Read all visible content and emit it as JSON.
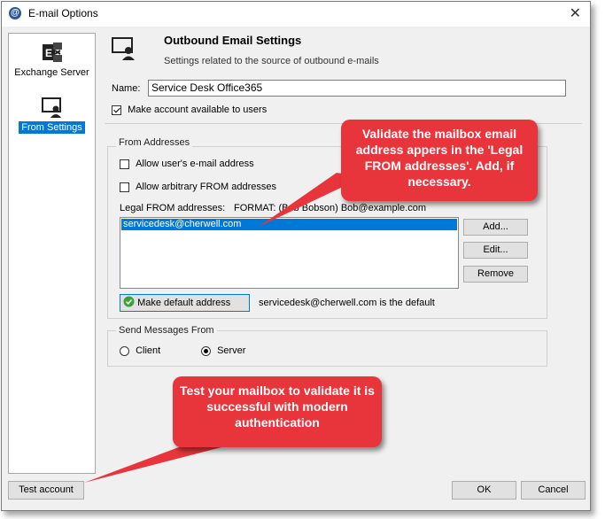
{
  "window": {
    "title": "E-mail Options",
    "close_symbol": "✕"
  },
  "sidebar": {
    "items": [
      {
        "label": "Exchange Server",
        "selected": false
      },
      {
        "label": "From Settings",
        "selected": true
      }
    ]
  },
  "header": {
    "title": "Outbound Email Settings",
    "subtitle": "Settings related to the source of outbound e-mails"
  },
  "name_field": {
    "label": "Name:",
    "value": "Service Desk Office365"
  },
  "make_available": {
    "label": "Make account available to users",
    "checked": true
  },
  "from_addresses": {
    "group_label": "From Addresses",
    "allow_user": {
      "label": "Allow user's e-mail address",
      "checked": false
    },
    "allow_arbitrary": {
      "label": "Allow arbitrary FROM addresses",
      "checked": false
    },
    "legal_label": "Legal FROM addresses:",
    "format_hint": "FORMAT: (Bob Bobson) Bob@example.com",
    "items": [
      "servicedesk@cherwell.com"
    ],
    "add_button": "Add...",
    "edit_button": "Edit...",
    "remove_button": "Remove",
    "make_default_button": "Make default address",
    "default_text": "servicedesk@cherwell.com is the default"
  },
  "send_from": {
    "group_label": "Send Messages From",
    "client": "Client",
    "server": "Server",
    "selected": "Server"
  },
  "footer": {
    "test_button": "Test account",
    "ok_button": "OK",
    "cancel_button": "Cancel"
  },
  "callouts": {
    "top": "Validate the mailbox email address appers in the 'Legal FROM addresses'. Add, if necessary.",
    "bottom": "Test your mailbox to validate it is successful with modern authentication"
  },
  "colors": {
    "accent": "#0078d7",
    "callout": "#e8353b"
  }
}
